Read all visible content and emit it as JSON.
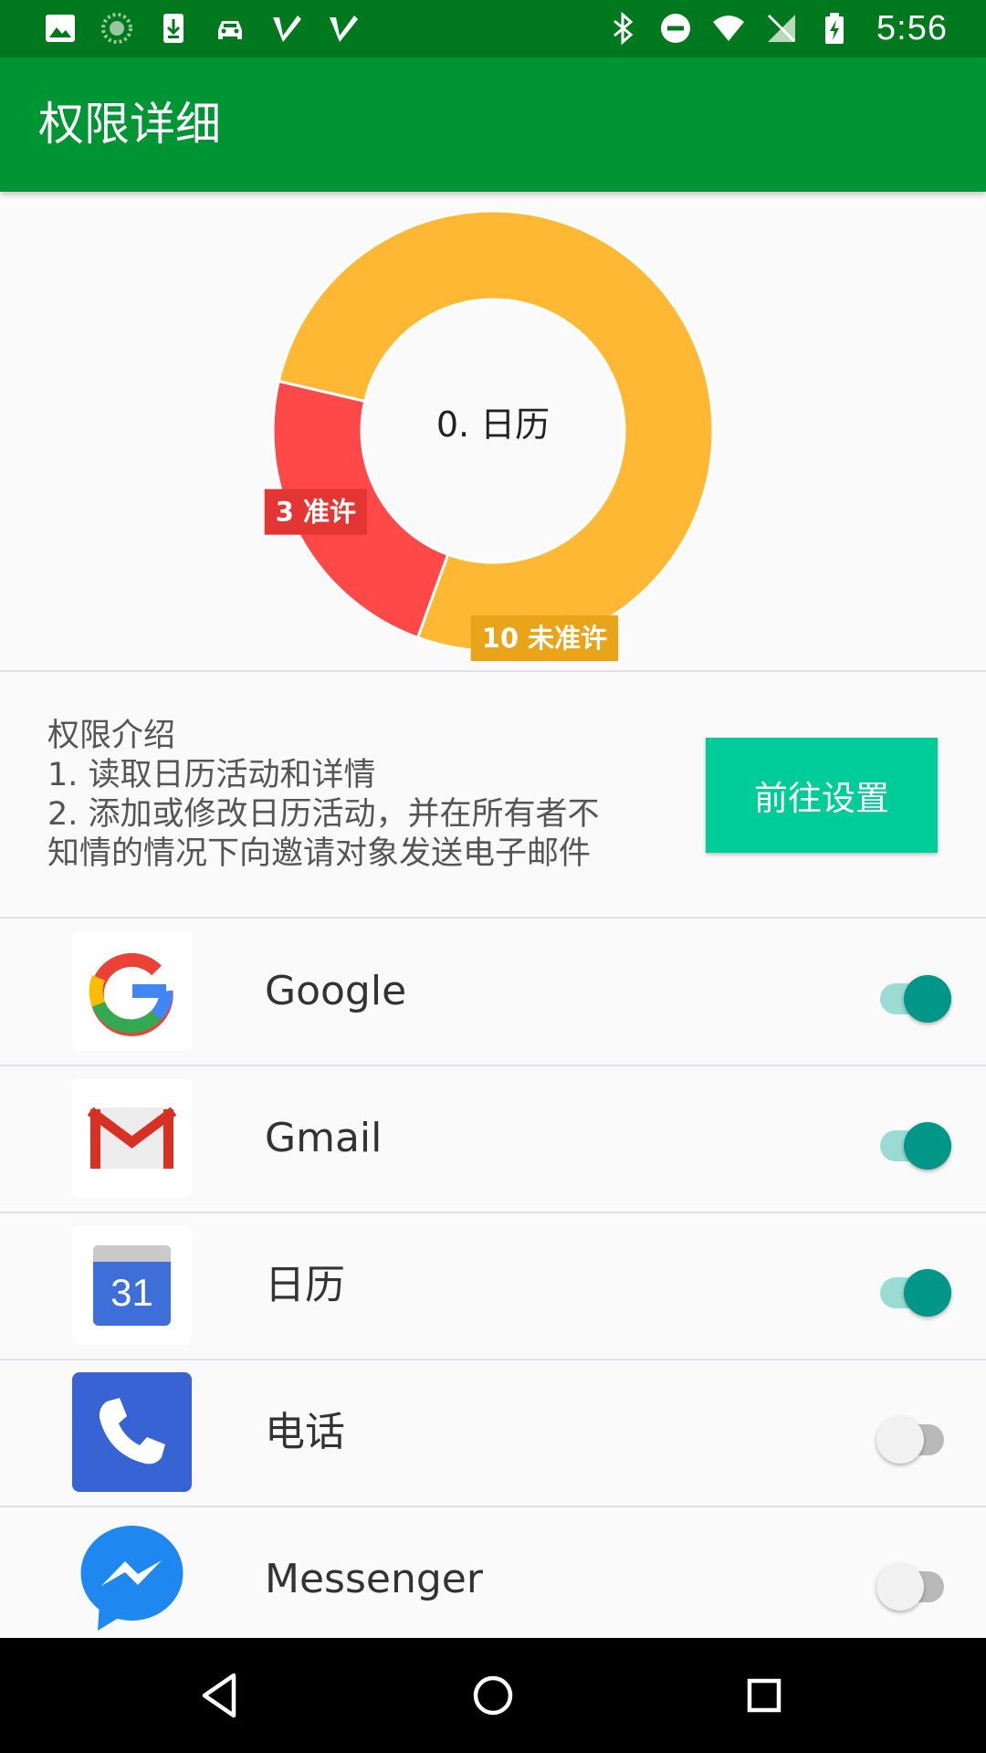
{
  "status_bar": {
    "time": "5:56",
    "left_icons": [
      "image-icon",
      "sync-icon",
      "download-icon",
      "car-icon",
      "check-icon",
      "check-icon"
    ],
    "right_icons": [
      "bluetooth-icon",
      "do-not-disturb-icon",
      "wifi-icon",
      "no-signal-icon",
      "battery-charging-icon"
    ]
  },
  "app_bar": {
    "title": "权限详细",
    "color": "#009534"
  },
  "chart_data": {
    "type": "pie",
    "center_label": "0. 日历",
    "slices": [
      {
        "label": "3 准许",
        "value": 3,
        "color": "#FF4848"
      },
      {
        "label": "10 未准许",
        "value": 10,
        "color": "#FFB833"
      }
    ]
  },
  "description": {
    "lines": [
      "权限介绍",
      "1. 读取日历活动和详情",
      "2. 添加或修改日历活动，并在所有者不",
      "知情的情况下向邀请对象发送电子邮件"
    ],
    "button_label": "前往设置",
    "button_color": "#00CC99"
  },
  "apps": [
    {
      "name": "Google",
      "icon": "google-icon",
      "enabled": true
    },
    {
      "name": "Gmail",
      "icon": "gmail-icon",
      "enabled": true
    },
    {
      "name": "日历",
      "icon": "calendar-icon",
      "enabled": true,
      "icon_text": "31"
    },
    {
      "name": "电话",
      "icon": "phone-icon",
      "enabled": false
    },
    {
      "name": "Messenger",
      "icon": "messenger-icon",
      "enabled": false
    }
  ],
  "nav_bar": {
    "icons": [
      "back-icon",
      "home-icon",
      "recents-icon"
    ]
  }
}
